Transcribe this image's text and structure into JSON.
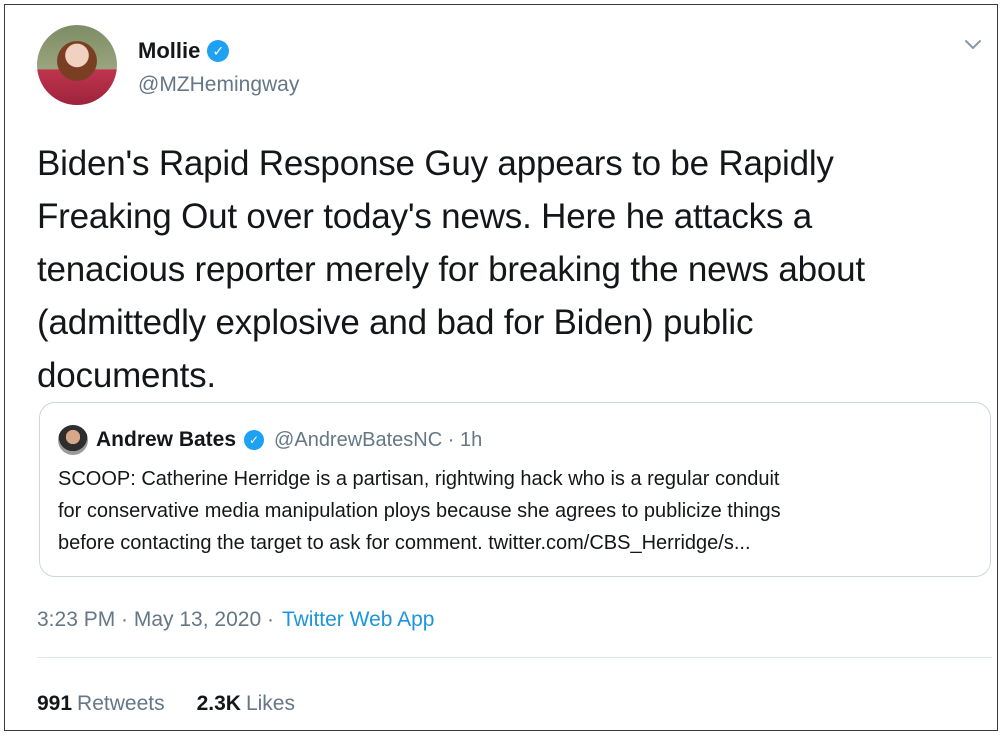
{
  "author": {
    "display_name": "Mollie",
    "handle": "@MZHemingway",
    "verified_icon": "verified-badge-icon"
  },
  "tweet": {
    "text_lines": [
      "Biden's Rapid Response Guy appears to be Rapidly",
      "Freaking Out over today's news. Here he attacks a",
      "tenacious reporter merely for breaking the news about",
      "(admittedly explosive and bad for Biden) public",
      "documents."
    ]
  },
  "quoted_tweet": {
    "display_name": "Andrew Bates",
    "meta": "@AndrewBatesNC · 1h",
    "text_lines": [
      "SCOOP: Catherine Herridge is a partisan, rightwing hack who is a regular conduit",
      "for conservative media manipulation ploys because she agrees to publicize things",
      "before contacting the target to ask for comment. twitter.com/CBS_Herridge/s..."
    ]
  },
  "footer": {
    "timestamp": "3:23 PM · May 13, 2020 ·",
    "source": "Twitter Web App"
  },
  "stats": {
    "retweets_count": "991",
    "retweets_label": "Retweets",
    "likes_count": "2.3K",
    "likes_label": "Likes"
  },
  "colors": {
    "accent": "#1da1f2",
    "link": "#1b95e0",
    "muted": "#657786"
  }
}
